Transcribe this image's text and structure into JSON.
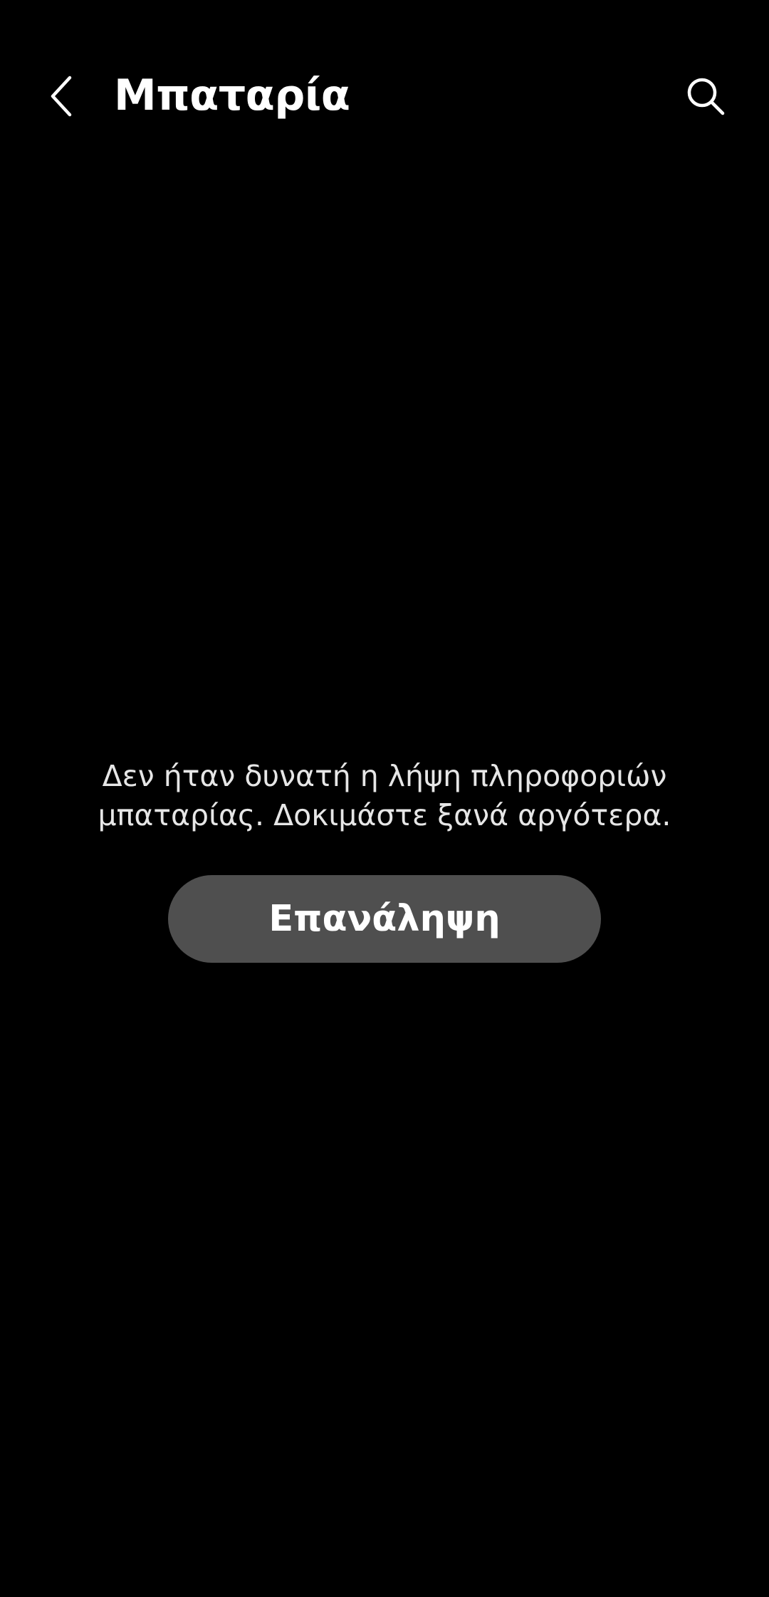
{
  "header": {
    "title": "Μπαταρία",
    "back_icon": "chevron-left-icon",
    "search_icon": "search-icon"
  },
  "message": {
    "line1": "Δεν ήταν δυνατή η λήψη πληροφοριών",
    "line2": "μπαταρίας. Δοκιμάστε ξανά αργότερα."
  },
  "retry": {
    "label": "Επανάληψη"
  },
  "colors": {
    "background": "#000000",
    "text": "#ffffff",
    "message_text": "#e6e6e6",
    "button_background": "#4f4f4f"
  }
}
